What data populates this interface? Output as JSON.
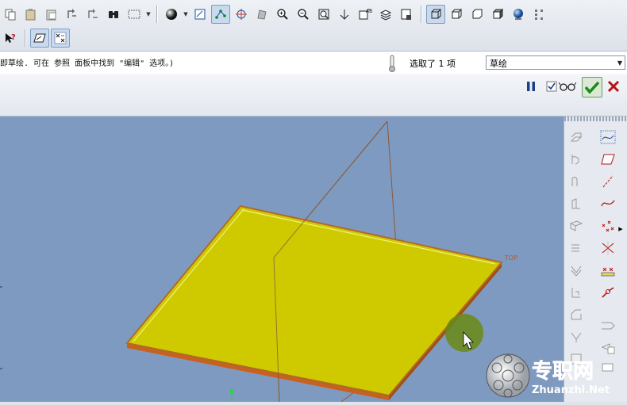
{
  "message": {
    "text": "即草绘. 可在 参照 面板中找到 \"编辑\" 选项。)"
  },
  "selection": {
    "status": "选取了 1 项",
    "filter_value": "草绘"
  },
  "viewport": {
    "plane_label": "TOP"
  },
  "watermark": {
    "brand": "专职网",
    "url": "Zhuanzhi.Net"
  },
  "colors": {
    "viewport_bg": "#7f9ac0",
    "plane_fill": "#cfca00",
    "plane_edge": "#b06a2a",
    "confirm_green": "#1c8a1c",
    "cancel_red": "#b41414"
  }
}
